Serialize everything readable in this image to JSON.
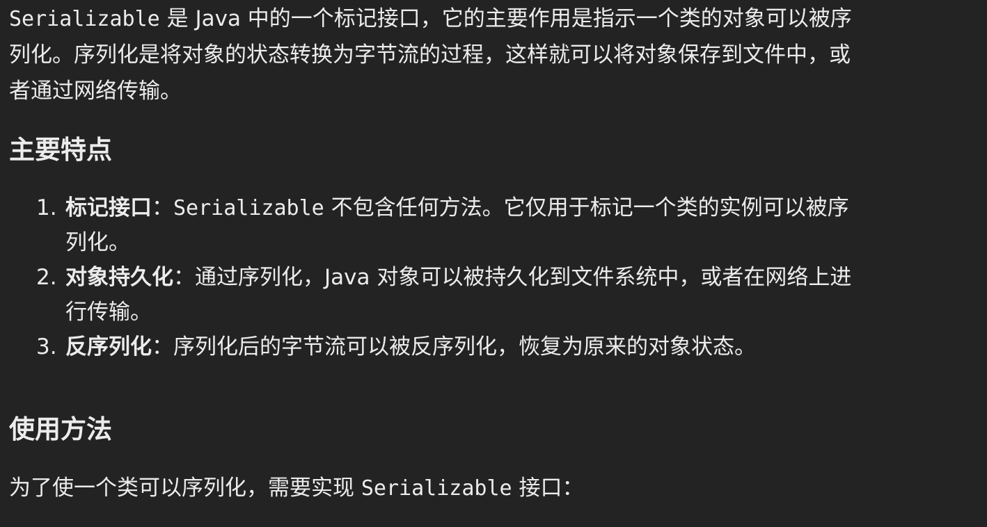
{
  "intro": {
    "code_term": "Serializable",
    "line1_rest": " 是 Java 中的一个标记接口，它的主要作用是指示一个类的对象可以被序",
    "line2": "列化。序列化是将对象的状态转换为字节流的过程，这样就可以将对象保存到文件中，或",
    "line3": "者通过网络传输。"
  },
  "features": {
    "heading": "主要特点",
    "items": [
      {
        "number": "1.",
        "term": "标记接口",
        "sep": "：",
        "code_term": "Serializable",
        "rest_line1": " 不包含任何方法。它仅用于标记一个类的实例可以被序",
        "line2": "列化。"
      },
      {
        "number": "2.",
        "term": "对象持久化",
        "sep": "：",
        "rest_line1": "通过序列化，Java 对象可以被持久化到文件系统中，或者在网络上进",
        "line2": "行传输。"
      },
      {
        "number": "3.",
        "term": "反序列化",
        "sep": "：",
        "rest_line1": "序列化后的字节流可以被反序列化，恢复为原来的对象状态。"
      }
    ]
  },
  "usage": {
    "heading": "使用方法",
    "text_before": "为了使一个类可以序列化，需要实现 ",
    "code_term": "Serializable",
    "text_after": " 接口："
  }
}
